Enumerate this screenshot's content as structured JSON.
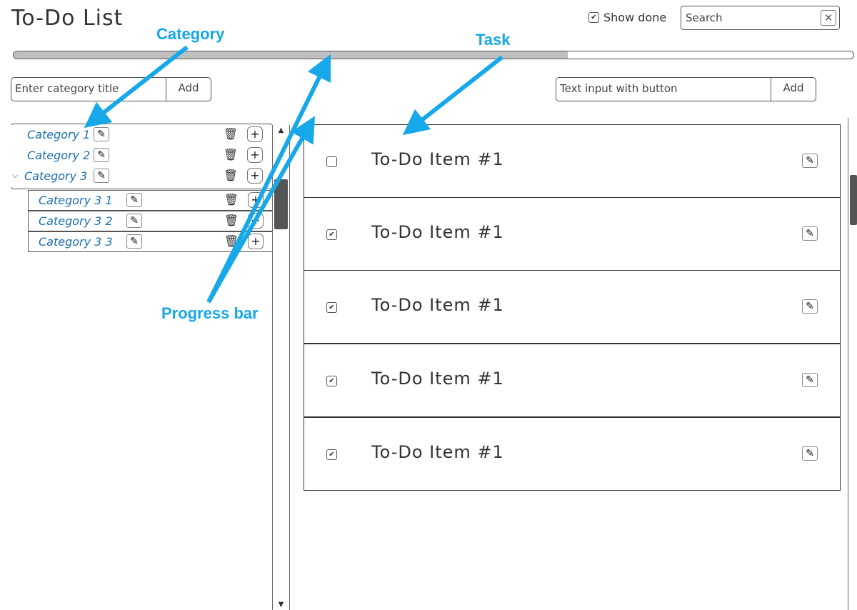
{
  "app": {
    "title": "To-Do List"
  },
  "header": {
    "show_done_label": "Show done",
    "show_done_checked": true,
    "search_placeholder": "Search",
    "search_clear": "✕",
    "progress": 0.66
  },
  "category_input": {
    "placeholder": "Enter category title",
    "add_label": "Add"
  },
  "task_input": {
    "placeholder": "Text input with button",
    "add_label": "Add"
  },
  "categories": [
    {
      "name": "Category 1",
      "expanded": false
    },
    {
      "name": "Category 2",
      "expanded": false
    },
    {
      "name": "Category 3",
      "expanded": true,
      "children": [
        {
          "name": "Category 3   1"
        },
        {
          "name": "Category 3   2"
        },
        {
          "name": "Category 3   3"
        }
      ]
    }
  ],
  "category_actions": {
    "expand_glyph": "⌵",
    "edit_glyph": "✎",
    "delete_glyph": "🗑",
    "add_glyph": "+"
  },
  "tasks": [
    {
      "title": "To-Do Item #1",
      "done": false
    },
    {
      "title": "To-Do Item #1",
      "done": true
    },
    {
      "title": "To-Do Item #1",
      "done": true
    },
    {
      "title": "To-Do Item #1",
      "done": true
    },
    {
      "title": "To-Do Item #1",
      "done": true
    }
  ],
  "annotations": {
    "category": "Category",
    "task": "Task",
    "progress_bar": "Progress bar",
    "color": "#16a8e8"
  },
  "colors": {
    "category_text": "#1d6fb0",
    "scroll_thumb": "#555555"
  }
}
